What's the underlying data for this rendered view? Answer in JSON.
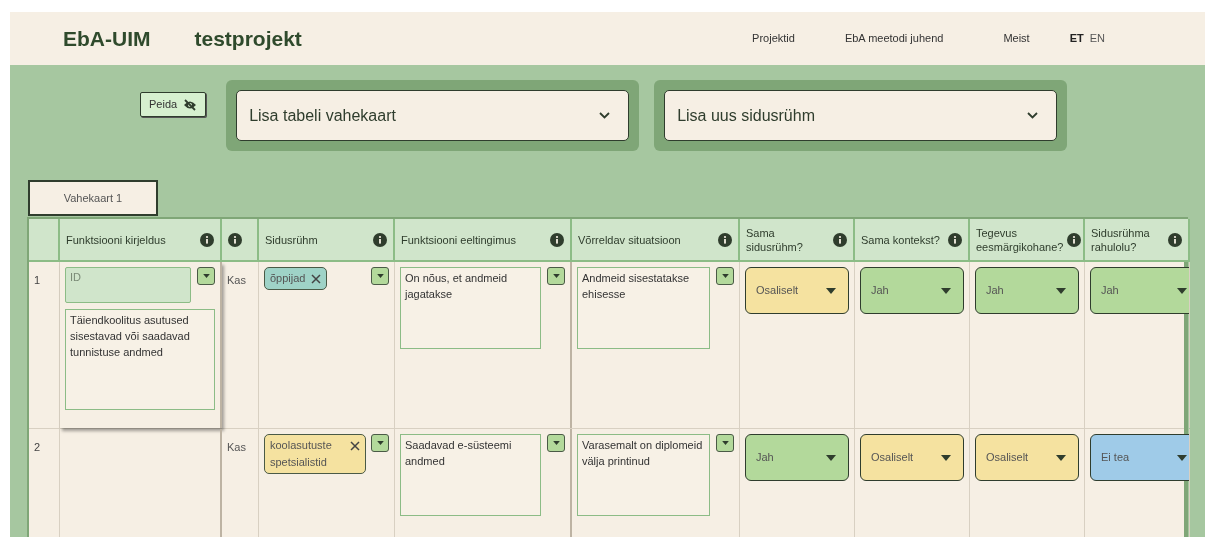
{
  "header": {
    "logo": "EbA-UIM",
    "project": "testprojekt",
    "nav": [
      {
        "label": "Projektid"
      },
      {
        "label": "EbA meetodi juhend"
      },
      {
        "label": "Meist"
      }
    ],
    "languages": [
      {
        "label": "ET",
        "selected": true
      },
      {
        "label": "EN",
        "selected": false
      }
    ]
  },
  "toolbar": {
    "hide_button": "Peida",
    "dropdowns": [
      {
        "label": "Lisa tabeli vahekaart"
      },
      {
        "label": "Lisa uus sidusrühm"
      }
    ]
  },
  "tabs": [
    {
      "label": "Vahekaart 1",
      "selected": true
    }
  ],
  "table": {
    "columns": [
      {
        "info": false
      },
      {
        "label": "Funktsiooni kirjeldus",
        "info": true
      },
      {
        "info": true
      },
      {
        "label": "Sidusrühm",
        "info": true
      },
      {
        "label": "Funktsiooni eeltingimus",
        "info": true
      },
      {
        "label": "Võrreldav situatsioon",
        "info": true
      },
      {
        "label": "Sama sidusrühm?",
        "info": true
      },
      {
        "label": "Sama kontekst?",
        "info": true
      },
      {
        "label": "Tegevus eesmärgikohane?",
        "info": true
      },
      {
        "label": "Sidusrühma rahulolu?",
        "info": true
      }
    ],
    "rows": [
      {
        "number": "1",
        "id_placeholder": "ID",
        "description": "Täiendkoolitus asutused sisestavad või saadavad tunnistuse andmed",
        "info": "Kas",
        "stakeholders": [
          {
            "label": "õppijad",
            "color": "#9fd3c7"
          }
        ],
        "precondition": "On nõus, et andmeid jagatakse",
        "comparison": "Andmeid sisestatakse ehisesse",
        "answers": [
          {
            "value": "Osaliselt",
            "color": "#f5e2a0"
          },
          {
            "value": "Jah",
            "color": "#b3d99b"
          },
          {
            "value": "Jah",
            "color": "#b3d99b"
          },
          {
            "value": "Jah",
            "color": "#b3d99b"
          }
        ]
      },
      {
        "number": "2",
        "info": "Kas",
        "stakeholders": [
          {
            "label": "koolasutuste spetsialistid",
            "color": "#f5e2a0"
          }
        ],
        "precondition": "Saadavad e-süsteemi andmed",
        "comparison": "Varasemalt on diplomeid välja printinud",
        "answers": [
          {
            "value": "Jah",
            "color": "#b3d99b"
          },
          {
            "value": "Osaliselt",
            "color": "#f5e2a0"
          },
          {
            "value": "Osaliselt",
            "color": "#f5e2a0"
          },
          {
            "value": "Ei tea",
            "color": "#9fcbe8"
          }
        ]
      }
    ]
  }
}
